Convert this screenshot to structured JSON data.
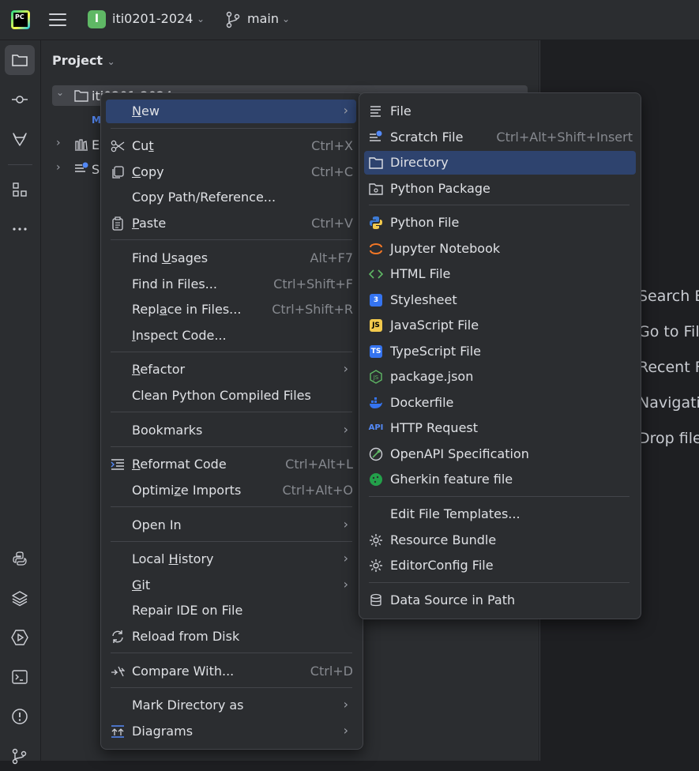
{
  "titlebar": {
    "project_badge": "I",
    "project_name": "iti0201-2024",
    "branch": "main"
  },
  "project_panel": {
    "title": "Project",
    "tree": [
      {
        "label": "iti0201-2024"
      },
      {
        "label": "M"
      },
      {
        "label": "E"
      },
      {
        "label": "S"
      }
    ]
  },
  "editor_hints": [
    "Search E",
    "Go to Fil",
    "Recent F",
    "Navigatio",
    "Drop file"
  ],
  "context_menu": {
    "items": [
      {
        "pre": "",
        "u": "N",
        "post": "ew",
        "shortcut": "",
        "submenu": true
      },
      {
        "pre": "Cu",
        "u": "t",
        "post": "",
        "shortcut": "Ctrl+X"
      },
      {
        "pre": "",
        "u": "C",
        "post": "opy",
        "shortcut": "Ctrl+C"
      },
      {
        "pre": "Copy Path/Reference...",
        "u": "",
        "post": "",
        "shortcut": ""
      },
      {
        "pre": "",
        "u": "P",
        "post": "aste",
        "shortcut": "Ctrl+V"
      },
      {
        "pre": "Find ",
        "u": "U",
        "post": "sages",
        "shortcut": "Alt+F7"
      },
      {
        "pre": "Find in Files...",
        "u": "",
        "post": "",
        "shortcut": "Ctrl+Shift+F"
      },
      {
        "pre": "Repl",
        "u": "a",
        "post": "ce in Files...",
        "shortcut": "Ctrl+Shift+R"
      },
      {
        "pre": "",
        "u": "I",
        "post": "nspect Code...",
        "shortcut": ""
      },
      {
        "pre": "",
        "u": "R",
        "post": "efactor",
        "shortcut": "",
        "submenu": true
      },
      {
        "pre": "Clean Python Compiled Files",
        "u": "",
        "post": "",
        "shortcut": ""
      },
      {
        "pre": "Bookmarks",
        "u": "",
        "post": "",
        "shortcut": "",
        "submenu": true
      },
      {
        "pre": "",
        "u": "R",
        "post": "eformat Code",
        "shortcut": "Ctrl+Alt+L"
      },
      {
        "pre": "Optimi",
        "u": "z",
        "post": "e Imports",
        "shortcut": "Ctrl+Alt+O"
      },
      {
        "pre": "Open In",
        "u": "",
        "post": "",
        "shortcut": "",
        "submenu": true
      },
      {
        "pre": "Local ",
        "u": "H",
        "post": "istory",
        "shortcut": "",
        "submenu": true
      },
      {
        "pre": "",
        "u": "G",
        "post": "it",
        "shortcut": "",
        "submenu": true
      },
      {
        "pre": "Repair IDE on File",
        "u": "",
        "post": "",
        "shortcut": ""
      },
      {
        "pre": "Reload from Disk",
        "u": "",
        "post": "",
        "shortcut": ""
      },
      {
        "pre": "Compare With...",
        "u": "",
        "post": "",
        "shortcut": "Ctrl+D"
      },
      {
        "pre": "Mark Directory as",
        "u": "",
        "post": "",
        "shortcut": "",
        "submenu": true
      },
      {
        "pre": "Diagrams",
        "u": "",
        "post": "",
        "shortcut": "",
        "submenu": true
      }
    ]
  },
  "new_submenu": {
    "items": [
      {
        "label": "File",
        "shortcut": ""
      },
      {
        "label": "Scratch File",
        "shortcut": "Ctrl+Alt+Shift+Insert"
      },
      {
        "label": "Directory",
        "shortcut": ""
      },
      {
        "label": "Python Package",
        "shortcut": ""
      },
      {
        "label": "Python File",
        "shortcut": ""
      },
      {
        "label": "Jupyter Notebook",
        "shortcut": ""
      },
      {
        "label": "HTML File",
        "shortcut": ""
      },
      {
        "label": "Stylesheet",
        "shortcut": ""
      },
      {
        "label": "JavaScript File",
        "shortcut": ""
      },
      {
        "label": "TypeScript File",
        "shortcut": ""
      },
      {
        "label": "package.json",
        "shortcut": ""
      },
      {
        "label": "Dockerfile",
        "shortcut": ""
      },
      {
        "label": "HTTP Request",
        "shortcut": ""
      },
      {
        "label": "OpenAPI Specification",
        "shortcut": ""
      },
      {
        "label": "Gherkin feature file",
        "shortcut": ""
      },
      {
        "label": "Edit File Templates...",
        "shortcut": ""
      },
      {
        "label": "Resource Bundle",
        "shortcut": ""
      },
      {
        "label": "EditorConfig File",
        "shortcut": ""
      },
      {
        "label": "Data Source in Path",
        "shortcut": ""
      }
    ],
    "icon_labels": {
      "api": "API",
      "js": "JS",
      "ts": "TS",
      "css": "3"
    }
  },
  "colors": {
    "selection": "#2e436e",
    "menu_bg": "#2b2d30",
    "accent_blue": "#3574f0"
  }
}
